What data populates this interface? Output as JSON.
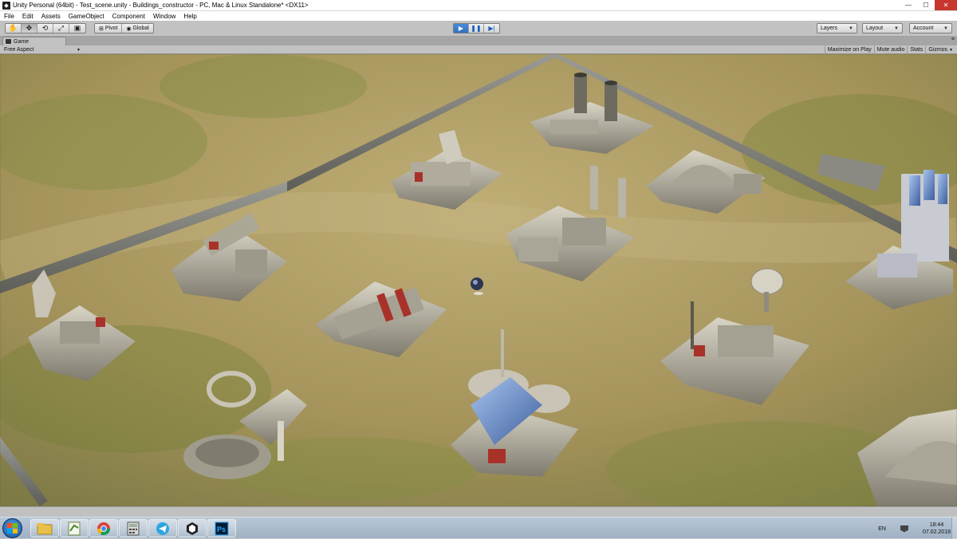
{
  "window": {
    "title": "Unity Personal (64bit) - Test_scene.unity - Buildings_constructor - PC, Mac & Linux Standalone* <DX11>",
    "minimize": "—",
    "maximize": "☐",
    "close": "✕"
  },
  "menu": {
    "items": [
      "File",
      "Edit",
      "Assets",
      "GameObject",
      "Component",
      "Window",
      "Help"
    ]
  },
  "toolbar": {
    "transform_tools": [
      "hand-icon",
      "move-icon",
      "rotate-icon",
      "scale-icon",
      "rect-icon"
    ],
    "pivot_label": "Pivot",
    "global_label": "Global",
    "play_state": "playing",
    "layers_label": "Layers",
    "layout_label": "Layout",
    "account_label": "Account"
  },
  "game_view": {
    "tab_label": "Game",
    "aspect_label": "Free Aspect",
    "maximize_on_play": "Maximize on Play",
    "mute_audio": "Mute audio",
    "stats": "Stats",
    "gizmos": "Gizmos"
  },
  "taskbar": {
    "apps": [
      "explorer-icon",
      "notepad-icon",
      "chrome-icon",
      "calculator-icon",
      "telegram-icon",
      "unity-icon",
      "photoshop-icon"
    ],
    "language": "EN",
    "time": "18:44",
    "date": "07.02.2018"
  },
  "colors": {
    "ground": "#a4935a",
    "play_accent": "#2f6fc2",
    "close_button": "#c7372f"
  }
}
